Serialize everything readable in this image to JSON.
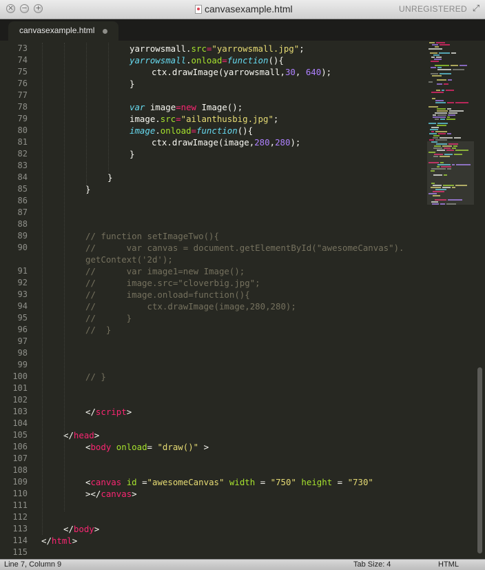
{
  "window": {
    "title": "canvasexample.html",
    "license": "UNREGISTERED"
  },
  "tabs": [
    {
      "label": "canvasexample.html",
      "modified": true
    }
  ],
  "editor": {
    "lines": [
      {
        "n": "73",
        "indent": 4,
        "tokens": [
          [
            "t",
            "yarrowsmall."
          ],
          [
            "at",
            "src"
          ],
          [
            "kw",
            "="
          ],
          [
            "st",
            "\"yarrowsmall.jpg\""
          ],
          [
            "t",
            ";"
          ]
        ]
      },
      {
        "n": "74",
        "indent": 4,
        "tokens": [
          [
            "fn",
            "yarrowsmall"
          ],
          [
            "t",
            "."
          ],
          [
            "at",
            "onload"
          ],
          [
            "kw",
            "="
          ],
          [
            "stor",
            "function"
          ],
          [
            "t",
            "(){"
          ]
        ]
      },
      {
        "n": "75",
        "indent": 5,
        "tokens": [
          [
            "t",
            "ctx.drawImage(yarrowsmall,"
          ],
          [
            "nm",
            "30"
          ],
          [
            "t",
            ", "
          ],
          [
            "nm",
            "640"
          ],
          [
            "t",
            ");"
          ]
        ]
      },
      {
        "n": "76",
        "indent": 4,
        "tokens": [
          [
            "t",
            "}"
          ]
        ]
      },
      {
        "n": "77",
        "indent": 0,
        "tokens": []
      },
      {
        "n": "78",
        "indent": 4,
        "tokens": [
          [
            "stor",
            "var"
          ],
          [
            "t",
            " image"
          ],
          [
            "kw",
            "="
          ],
          [
            "kw",
            "new"
          ],
          [
            "t",
            " Image();"
          ]
        ]
      },
      {
        "n": "79",
        "indent": 4,
        "tokens": [
          [
            "t",
            "image."
          ],
          [
            "at",
            "src"
          ],
          [
            "kw",
            "="
          ],
          [
            "st",
            "\"ailanthusbig.jpg\""
          ],
          [
            "t",
            ";"
          ]
        ]
      },
      {
        "n": "80",
        "indent": 4,
        "tokens": [
          [
            "fn",
            "image"
          ],
          [
            "t",
            "."
          ],
          [
            "at",
            "onload"
          ],
          [
            "kw",
            "="
          ],
          [
            "stor",
            "function"
          ],
          [
            "t",
            "(){"
          ]
        ]
      },
      {
        "n": "81",
        "indent": 5,
        "tokens": [
          [
            "t",
            "ctx.drawImage(image,"
          ],
          [
            "nm",
            "280"
          ],
          [
            "t",
            ","
          ],
          [
            "nm",
            "280"
          ],
          [
            "t",
            ");"
          ]
        ]
      },
      {
        "n": "82",
        "indent": 4,
        "tokens": [
          [
            "t",
            "}"
          ]
        ]
      },
      {
        "n": "83",
        "indent": 0,
        "tokens": []
      },
      {
        "n": "84",
        "indent": 3,
        "tokens": [
          [
            "t",
            "}"
          ]
        ]
      },
      {
        "n": "85",
        "indent": 2,
        "tokens": [
          [
            "t",
            "}"
          ]
        ]
      },
      {
        "n": "86",
        "indent": 0,
        "tokens": []
      },
      {
        "n": "87",
        "indent": 0,
        "tokens": []
      },
      {
        "n": "88",
        "indent": 0,
        "tokens": []
      },
      {
        "n": "89",
        "indent": 2,
        "tokens": [
          [
            "cm",
            "// function setImageTwo(){"
          ]
        ]
      },
      {
        "n": "90",
        "indent": 2,
        "tokens": [
          [
            "cm",
            "//      var canvas = document.getElementById(\"awesomeCanvas\")."
          ]
        ]
      },
      {
        "n": "",
        "indent": 2,
        "tokens": [
          [
            "cm",
            "getContext('2d');"
          ]
        ]
      },
      {
        "n": "91",
        "indent": 2,
        "tokens": [
          [
            "cm",
            "//      var image1=new Image();"
          ]
        ]
      },
      {
        "n": "92",
        "indent": 2,
        "tokens": [
          [
            "cm",
            "//      image.src=\"cloverbig.jpg\";"
          ]
        ]
      },
      {
        "n": "93",
        "indent": 2,
        "tokens": [
          [
            "cm",
            "//      image.onload=function(){"
          ]
        ]
      },
      {
        "n": "94",
        "indent": 2,
        "tokens": [
          [
            "cm",
            "//          ctx.drawImage(image,280,280);"
          ]
        ]
      },
      {
        "n": "95",
        "indent": 2,
        "tokens": [
          [
            "cm",
            "//      }"
          ]
        ]
      },
      {
        "n": "96",
        "indent": 2,
        "tokens": [
          [
            "cm",
            "//  }"
          ]
        ]
      },
      {
        "n": "97",
        "indent": 0,
        "tokens": []
      },
      {
        "n": "98",
        "indent": 0,
        "tokens": []
      },
      {
        "n": "99",
        "indent": 0,
        "tokens": []
      },
      {
        "n": "100",
        "indent": 2,
        "tokens": [
          [
            "cm",
            "// }"
          ]
        ]
      },
      {
        "n": "101",
        "indent": 0,
        "tokens": []
      },
      {
        "n": "102",
        "indent": 0,
        "tokens": []
      },
      {
        "n": "103",
        "indent": 2,
        "tokens": [
          [
            "t",
            "</"
          ],
          [
            "kw",
            "script"
          ],
          [
            "t",
            ">"
          ]
        ]
      },
      {
        "n": "104",
        "indent": 0,
        "tokens": []
      },
      {
        "n": "105",
        "indent": 1,
        "tokens": [
          [
            "t",
            "</"
          ],
          [
            "kw",
            "head"
          ],
          [
            "t",
            ">"
          ]
        ]
      },
      {
        "n": "106",
        "indent": 2,
        "tokens": [
          [
            "t",
            "<"
          ],
          [
            "kw",
            "body"
          ],
          [
            "t",
            " "
          ],
          [
            "at",
            "onload"
          ],
          [
            "t",
            "= "
          ],
          [
            "st",
            "\"draw()\""
          ],
          [
            "t",
            " >"
          ]
        ]
      },
      {
        "n": "107",
        "indent": 0,
        "tokens": []
      },
      {
        "n": "108",
        "indent": 0,
        "tokens": []
      },
      {
        "n": "109",
        "indent": 2,
        "tokens": [
          [
            "t",
            "<"
          ],
          [
            "kw",
            "canvas"
          ],
          [
            "t",
            " "
          ],
          [
            "at",
            "id"
          ],
          [
            "t",
            " ="
          ],
          [
            "st",
            "\"awesomeCanvas\""
          ],
          [
            "t",
            " "
          ],
          [
            "at",
            "width"
          ],
          [
            "t",
            " = "
          ],
          [
            "st",
            "\"750\""
          ],
          [
            "t",
            " "
          ],
          [
            "at",
            "height"
          ],
          [
            "t",
            " = "
          ],
          [
            "st",
            "\"730\""
          ]
        ]
      },
      {
        "n": "110",
        "indent": 2,
        "tokens": [
          [
            "t",
            "></"
          ],
          [
            "kw",
            "canvas"
          ],
          [
            "t",
            ">"
          ]
        ]
      },
      {
        "n": "111",
        "indent": 0,
        "tokens": []
      },
      {
        "n": "112",
        "indent": 0,
        "tokens": []
      },
      {
        "n": "113",
        "indent": 1,
        "tokens": [
          [
            "t",
            "</"
          ],
          [
            "kw",
            "body"
          ],
          [
            "t",
            ">"
          ]
        ]
      },
      {
        "n": "114",
        "indent": 0,
        "tokens": [
          [
            "t",
            "</"
          ],
          [
            "kw",
            "html"
          ],
          [
            "t",
            ">"
          ]
        ]
      },
      {
        "n": "115",
        "indent": 0,
        "tokens": []
      }
    ]
  },
  "status": {
    "position": "Line 7, Column 9",
    "tab_size": "Tab Size: 4",
    "syntax": "HTML"
  },
  "colors": {
    "background": "#272822",
    "keyword": "#f92672",
    "string": "#e6db74",
    "attribute": "#a6e22e",
    "number": "#ae81ff",
    "comment": "#75715e",
    "storage": "#66d9ef"
  }
}
